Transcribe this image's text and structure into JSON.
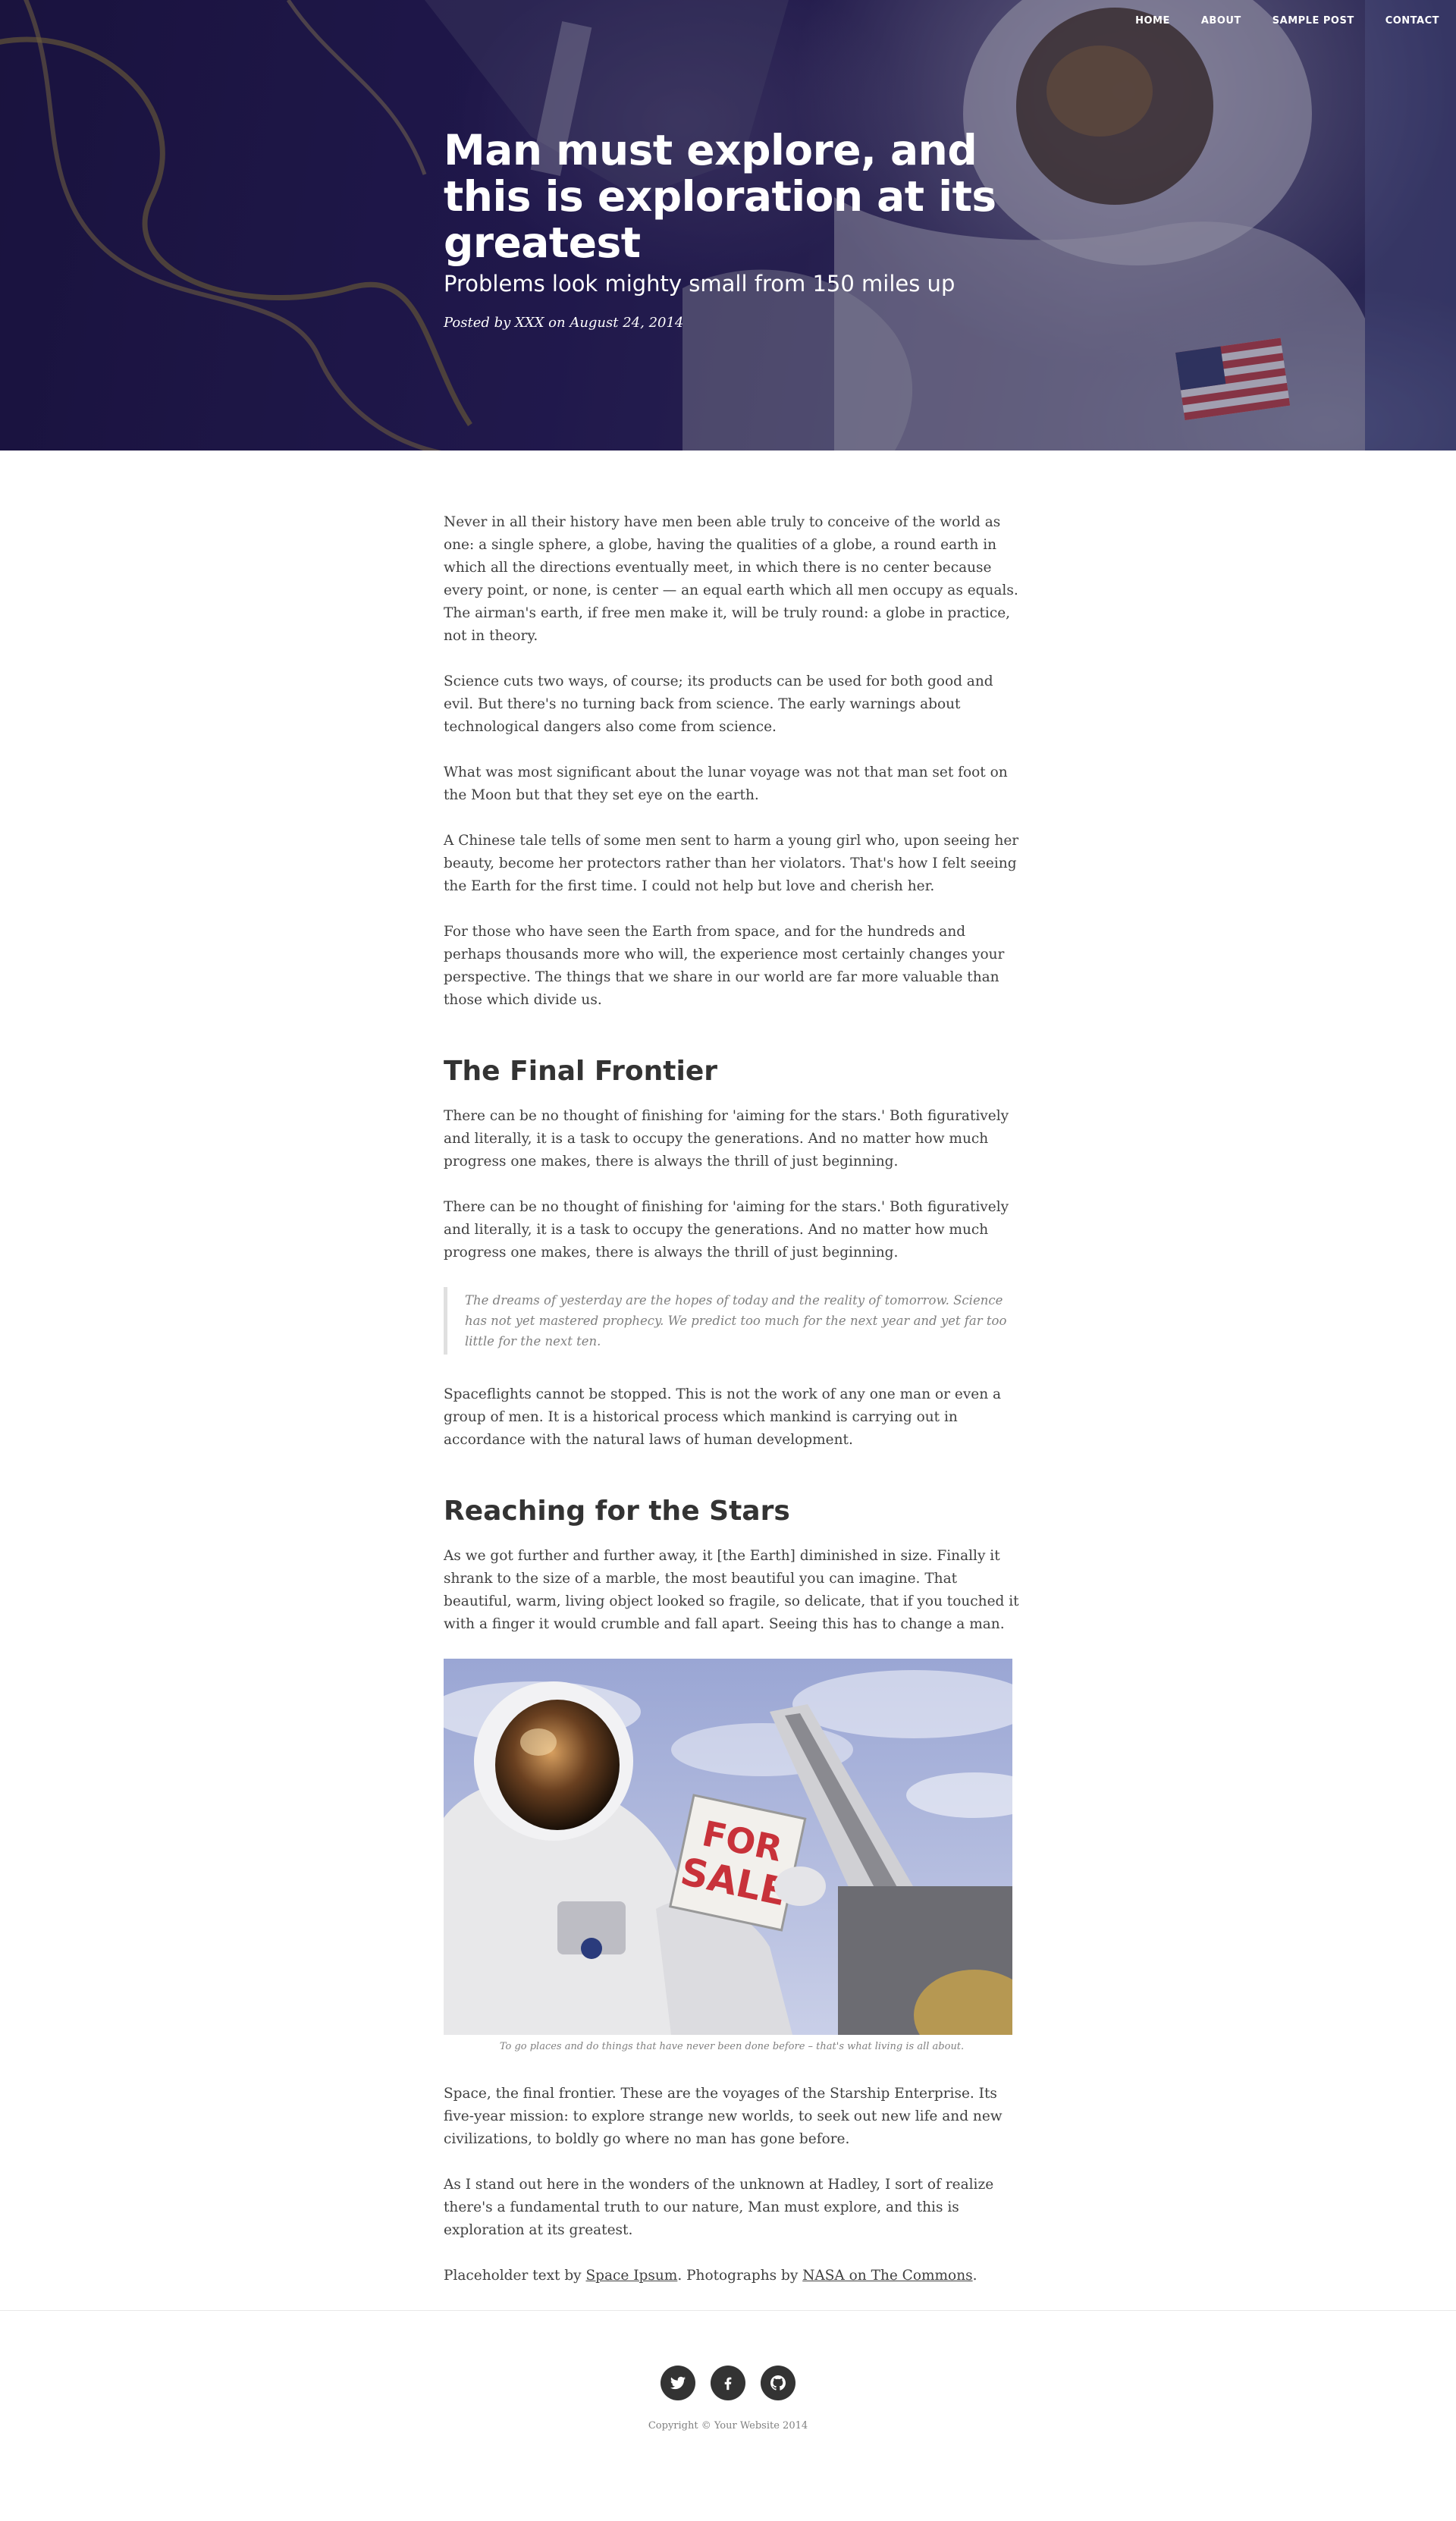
{
  "nav": {
    "items": [
      {
        "label": "HOME"
      },
      {
        "label": "ABOUT"
      },
      {
        "label": "SAMPLE POST"
      },
      {
        "label": "CONTACT"
      }
    ]
  },
  "header": {
    "title": "Man must explore, and this is exploration at its greatest",
    "subtitle": "Problems look mighty small from 150 miles up",
    "meta": "Posted by XXX on August 24, 2014"
  },
  "article": {
    "intro": [
      "Never in all their history have men been able truly to conceive of the world as one: a single sphere, a globe, having the qualities of a globe, a round earth in which all the directions eventually meet, in which there is no center because every point, or none, is center — an equal earth which all men occupy as equals. The airman's earth, if free men make it, will be truly round: a globe in practice, not in theory.",
      "Science cuts two ways, of course; its products can be used for both good and evil. But there's no turning back from science. The early warnings about technological dangers also come from science.",
      "What was most significant about the lunar voyage was not that man set foot on the Moon but that they set eye on the earth.",
      "A Chinese tale tells of some men sent to harm a young girl who, upon seeing her beauty, become her protectors rather than her violators. That's how I felt seeing the Earth for the first time. I could not help but love and cherish her.",
      "For those who have seen the Earth from space, and for the hundreds and perhaps thousands more who will, the experience most certainly changes your perspective. The things that we share in our world are far more valuable than those which divide us."
    ],
    "section1": {
      "heading": "The Final Frontier",
      "p1": "There can be no thought of finishing for 'aiming for the stars.' Both figuratively and literally, it is a task to occupy the generations. And no matter how much progress one makes, there is always the thrill of just beginning.",
      "p2": "There can be no thought of finishing for 'aiming for the stars.' Both figuratively and literally, it is a task to occupy the generations. And no matter how much progress one makes, there is always the thrill of just beginning.",
      "quote": "The dreams of yesterday are the hopes of today and the reality of tomorrow. Science has not yet mastered prophecy. We predict too much for the next year and yet far too little for the next ten.",
      "p3": "Spaceflights cannot be stopped. This is not the work of any one man or even a group of men. It is a historical process which mankind is carrying out in accordance with the natural laws of human development."
    },
    "section2": {
      "heading": "Reaching for the Stars",
      "p1": "As we got further and further away, it [the Earth] diminished in size. Finally it shrank to the size of a marble, the most beautiful you can imagine. That beautiful, warm, living object looked so fragile, so delicate, that if you touched it with a finger it would crumble and fall apart. Seeing this has to change a man.",
      "sign_line1": "FOR",
      "sign_line2": "SALE",
      "caption": "To go places and do things that have never been done before – that's what living is all about.",
      "p2": "Space, the final frontier. These are the voyages of the Starship Enterprise. Its five-year mission: to explore strange new worlds, to seek out new life and new civilizations, to boldly go where no man has gone before.",
      "p3": "As I stand out here in the wonders of the unknown at Hadley, I sort of realize there's a fundamental truth to our nature, Man must explore, and this is exploration at its greatest."
    },
    "credits": {
      "prefix": "Placeholder text by ",
      "link1": "Space Ipsum",
      "middle": ". Photographs by ",
      "link2": "NASA on The Commons",
      "suffix": "."
    }
  },
  "footer": {
    "social": [
      {
        "icon": "twitter-icon"
      },
      {
        "icon": "facebook-icon"
      },
      {
        "icon": "github-icon"
      }
    ],
    "copyright": "Copyright © Your Website 2014"
  },
  "colors": {
    "header_dark": "#1c1542",
    "text": "#404040",
    "heading": "#333333",
    "muted": "#808080",
    "social_circle": "#333333"
  }
}
